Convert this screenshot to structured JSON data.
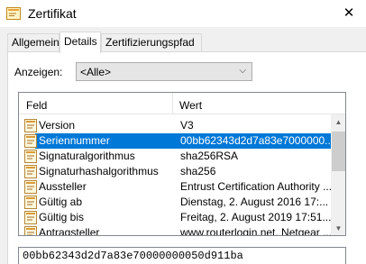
{
  "window": {
    "title": "Zertifikat"
  },
  "tabs": [
    {
      "label": "Allgemein"
    },
    {
      "label": "Details"
    },
    {
      "label": "Zertifizierungspfad"
    }
  ],
  "show": {
    "label": "Anzeigen:",
    "selected": "<Alle>"
  },
  "list": {
    "columns": {
      "field": "Feld",
      "value": "Wert"
    },
    "rows": [
      {
        "field": "Version",
        "value": "V3"
      },
      {
        "field": "Seriennummer",
        "value": "00bb62343d2d7a83e7000000..."
      },
      {
        "field": "Signaturalgorithmus",
        "value": "sha256RSA"
      },
      {
        "field": "Signaturhashalgorithmus",
        "value": "sha256"
      },
      {
        "field": "Aussteller",
        "value": "Entrust Certification Authority ..."
      },
      {
        "field": "Gültig ab",
        "value": "Dienstag, 2. August 2016 17:..."
      },
      {
        "field": "Gültig bis",
        "value": "Freitag, 2. August 2019 17:51..."
      },
      {
        "field": "Antragsteller",
        "value": "www.routerlogin.net, Netgear ..."
      }
    ],
    "selected_index": 1
  },
  "detail_value": "00bb62343d2d7a83e70000000050d911ba",
  "colors": {
    "selection": "#0078d7",
    "window_bg": "#f0f0f0"
  }
}
